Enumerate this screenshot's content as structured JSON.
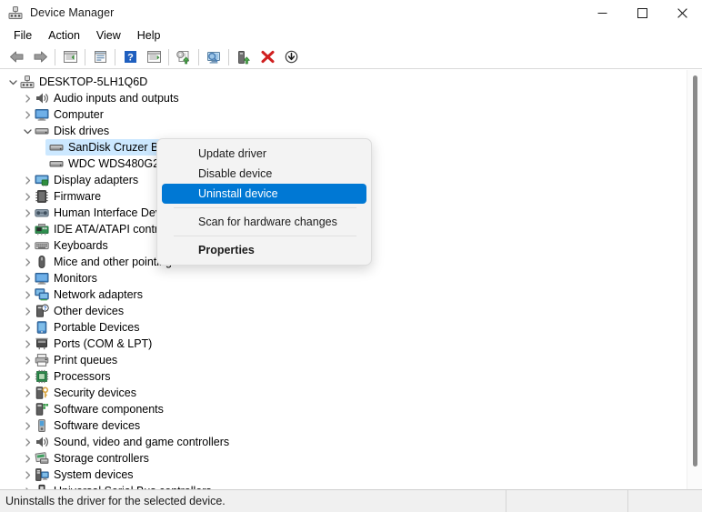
{
  "window": {
    "title": "Device Manager",
    "icon": "device-manager-icon",
    "controls": {
      "minimize": "─",
      "maximize": "☐",
      "close": "✕"
    }
  },
  "menubar": {
    "items": [
      {
        "label": "File"
      },
      {
        "label": "Action"
      },
      {
        "label": "View"
      },
      {
        "label": "Help"
      }
    ]
  },
  "toolbar": {
    "buttons": [
      {
        "name": "back-arrow-icon",
        "title": "Back"
      },
      {
        "name": "forward-arrow-icon",
        "title": "Forward"
      },
      {
        "name": "separator-1",
        "title": ""
      },
      {
        "name": "show-hide-console-tree-icon",
        "title": "Show/Hide Console Tree"
      },
      {
        "name": "separator-2",
        "title": ""
      },
      {
        "name": "properties-icon",
        "title": "Properties"
      },
      {
        "name": "separator-3",
        "title": ""
      },
      {
        "name": "help-icon",
        "title": "Help"
      },
      {
        "name": "view-icon",
        "title": "View"
      },
      {
        "name": "separator-4",
        "title": ""
      },
      {
        "name": "update-driver-icon",
        "title": "Update driver"
      },
      {
        "name": "separator-5",
        "title": ""
      },
      {
        "name": "scan-for-hardware-changes-icon",
        "title": "Scan for hardware changes"
      },
      {
        "name": "separator-6",
        "title": ""
      },
      {
        "name": "enable-device-icon",
        "title": "Enable device"
      },
      {
        "name": "uninstall-device-icon",
        "title": "Uninstall device"
      },
      {
        "name": "disable-device-icon",
        "title": "Disable device"
      }
    ]
  },
  "tree": {
    "nodes": [
      {
        "label": "DESKTOP-5LH1Q6D",
        "level": 0,
        "expanded": true,
        "twisty": "down",
        "icon": "computer-root-icon",
        "selected": false
      },
      {
        "label": "Audio inputs and outputs",
        "level": 1,
        "expanded": false,
        "twisty": "right",
        "icon": "speaker-icon",
        "selected": false
      },
      {
        "label": "Computer",
        "level": 1,
        "expanded": false,
        "twisty": "right",
        "icon": "monitor-icon",
        "selected": false
      },
      {
        "label": "Disk drives",
        "level": 1,
        "expanded": true,
        "twisty": "down",
        "icon": "disk-drive-icon",
        "selected": false
      },
      {
        "label": "SanDisk Cruzer Bl",
        "level": 2,
        "expanded": false,
        "twisty": "none",
        "icon": "disk-drive-icon",
        "selected": true
      },
      {
        "label": "WDC WDS480G2G",
        "level": 2,
        "expanded": false,
        "twisty": "none",
        "icon": "disk-drive-icon",
        "selected": false
      },
      {
        "label": "Display adapters",
        "level": 1,
        "expanded": false,
        "twisty": "right",
        "icon": "display-adapter-icon",
        "selected": false
      },
      {
        "label": "Firmware",
        "level": 1,
        "expanded": false,
        "twisty": "right",
        "icon": "firmware-chip-icon",
        "selected": false
      },
      {
        "label": "Human Interface Dev",
        "level": 1,
        "expanded": false,
        "twisty": "right",
        "icon": "human-interface-icon",
        "selected": false
      },
      {
        "label": "IDE ATA/ATAPI contro",
        "level": 1,
        "expanded": false,
        "twisty": "right",
        "icon": "ide-controller-icon",
        "selected": false
      },
      {
        "label": "Keyboards",
        "level": 1,
        "expanded": false,
        "twisty": "right",
        "icon": "keyboard-icon",
        "selected": false
      },
      {
        "label": "Mice and other pointing devices",
        "level": 1,
        "expanded": false,
        "twisty": "right",
        "icon": "mouse-icon",
        "selected": false
      },
      {
        "label": "Monitors",
        "level": 1,
        "expanded": false,
        "twisty": "right",
        "icon": "monitor-icon",
        "selected": false
      },
      {
        "label": "Network adapters",
        "level": 1,
        "expanded": false,
        "twisty": "right",
        "icon": "network-adapter-icon",
        "selected": false
      },
      {
        "label": "Other devices",
        "level": 1,
        "expanded": false,
        "twisty": "right",
        "icon": "other-device-icon",
        "selected": false
      },
      {
        "label": "Portable Devices",
        "level": 1,
        "expanded": false,
        "twisty": "right",
        "icon": "portable-device-icon",
        "selected": false
      },
      {
        "label": "Ports (COM & LPT)",
        "level": 1,
        "expanded": false,
        "twisty": "right",
        "icon": "port-icon",
        "selected": false
      },
      {
        "label": "Print queues",
        "level": 1,
        "expanded": false,
        "twisty": "right",
        "icon": "printer-icon",
        "selected": false
      },
      {
        "label": "Processors",
        "level": 1,
        "expanded": false,
        "twisty": "right",
        "icon": "processor-icon",
        "selected": false
      },
      {
        "label": "Security devices",
        "level": 1,
        "expanded": false,
        "twisty": "right",
        "icon": "security-device-icon",
        "selected": false
      },
      {
        "label": "Software components",
        "level": 1,
        "expanded": false,
        "twisty": "right",
        "icon": "software-component-icon",
        "selected": false
      },
      {
        "label": "Software devices",
        "level": 1,
        "expanded": false,
        "twisty": "right",
        "icon": "software-device-icon",
        "selected": false
      },
      {
        "label": "Sound, video and game controllers",
        "level": 1,
        "expanded": false,
        "twisty": "right",
        "icon": "sound-video-icon",
        "selected": false
      },
      {
        "label": "Storage controllers",
        "level": 1,
        "expanded": false,
        "twisty": "right",
        "icon": "storage-controller-icon",
        "selected": false
      },
      {
        "label": "System devices",
        "level": 1,
        "expanded": false,
        "twisty": "right",
        "icon": "system-device-icon",
        "selected": false
      },
      {
        "label": "Universal Serial Bus controllers",
        "level": 1,
        "expanded": false,
        "twisty": "right",
        "icon": "usb-controller-icon",
        "selected": false
      }
    ]
  },
  "context_menu": {
    "items": [
      {
        "label": "Update driver",
        "type": "item",
        "highlighted": false,
        "bold": false
      },
      {
        "label": "Disable device",
        "type": "item",
        "highlighted": false,
        "bold": false
      },
      {
        "label": "Uninstall device",
        "type": "item",
        "highlighted": true,
        "bold": false
      },
      {
        "label": "",
        "type": "separator",
        "highlighted": false,
        "bold": false
      },
      {
        "label": "Scan for hardware changes",
        "type": "item",
        "highlighted": false,
        "bold": false
      },
      {
        "label": "",
        "type": "separator",
        "highlighted": false,
        "bold": false
      },
      {
        "label": "Properties",
        "type": "item",
        "highlighted": false,
        "bold": true
      }
    ]
  },
  "statusbar": {
    "message": "Uninstalls the driver for the selected device.",
    "cell2": "",
    "cell3": ""
  },
  "colors": {
    "accent": "#0078d4",
    "selection": "#cce8ff",
    "window_bg": "#ffffff",
    "statusbar_bg": "#f0f0f0",
    "menu_bg": "#f3f3f3"
  }
}
